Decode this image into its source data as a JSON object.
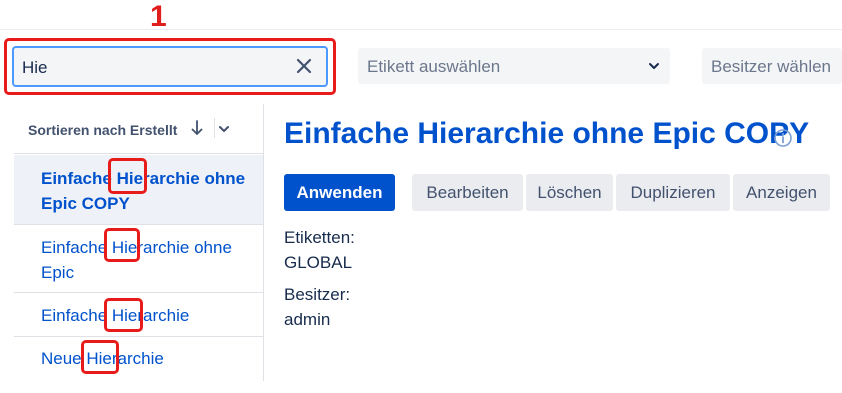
{
  "annotation": {
    "number": "1"
  },
  "search": {
    "value": "Hie"
  },
  "filters": {
    "label_placeholder": "Etikett auswählen",
    "owner_placeholder": "Besitzer wählen"
  },
  "sidebar": {
    "sort_label": "Sortieren nach Erstellt",
    "items": [
      {
        "label": "Einfache Hierarchie ohne Epic COPY",
        "selected": true
      },
      {
        "label": "Einfache Hierarchie ohne Epic",
        "selected": false
      },
      {
        "label": "Einfache Hierarchie",
        "selected": false
      },
      {
        "label": "Neue Hierarchie",
        "selected": false
      }
    ]
  },
  "detail": {
    "title": "Einfache Hierarchie ohne Epic COPY",
    "buttons": {
      "apply": "Anwenden",
      "edit": "Bearbeiten",
      "delete": "Löschen",
      "duplicate": "Duplizieren",
      "view": "Anzeigen"
    },
    "labels_heading": "Etiketten:",
    "labels_value": "GLOBAL",
    "owner_heading": "Besitzer:",
    "owner_value": "admin"
  },
  "colors": {
    "accent": "#0052cc",
    "annotation": "#e81b1b",
    "focus": "#4c9aff"
  }
}
